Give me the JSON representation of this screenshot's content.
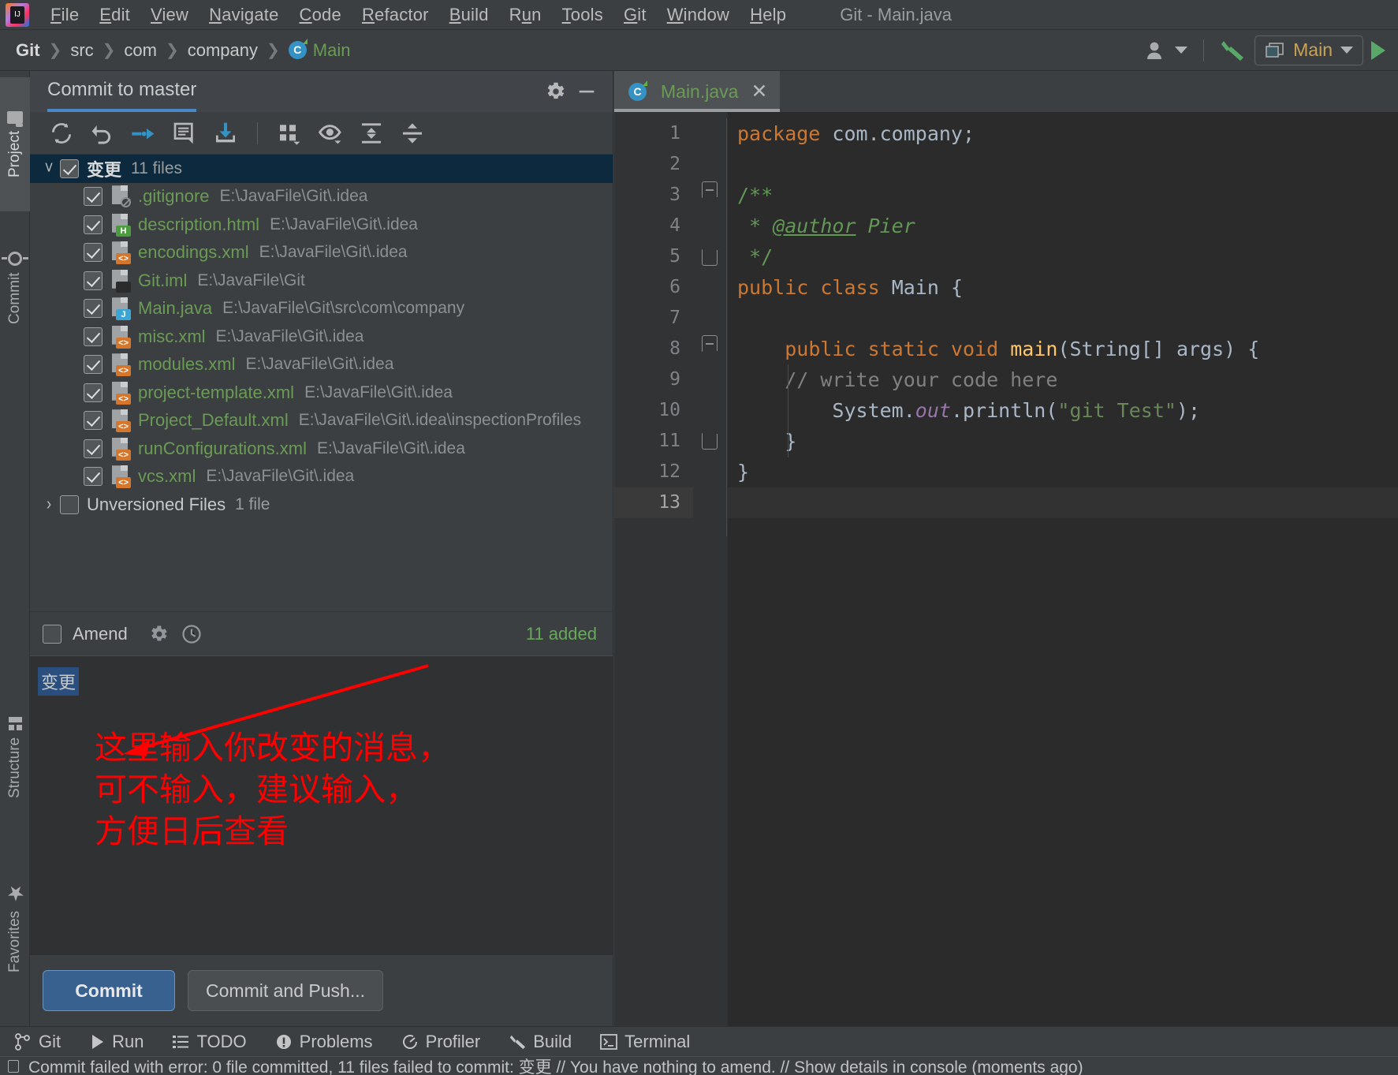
{
  "window": {
    "title": "Git - Main.java"
  },
  "menu": [
    {
      "label": "File",
      "mnemonic": "F"
    },
    {
      "label": "Edit",
      "mnemonic": "E"
    },
    {
      "label": "View",
      "mnemonic": "V"
    },
    {
      "label": "Navigate",
      "mnemonic": "N"
    },
    {
      "label": "Code",
      "mnemonic": "C"
    },
    {
      "label": "Refactor",
      "mnemonic": "R"
    },
    {
      "label": "Build",
      "mnemonic": "B"
    },
    {
      "label": "Run",
      "mnemonic": "u"
    },
    {
      "label": "Tools",
      "mnemonic": "T"
    },
    {
      "label": "Git",
      "mnemonic": "G"
    },
    {
      "label": "Window",
      "mnemonic": "W"
    },
    {
      "label": "Help",
      "mnemonic": "H"
    }
  ],
  "navbar": {
    "crumbs": [
      "Git",
      "src",
      "com",
      "company",
      "Main"
    ],
    "run_config": "Main"
  },
  "toolstrip": {
    "top": [
      {
        "label": "Project",
        "icon": "folder-icon",
        "selected": true
      },
      {
        "label": "Commit",
        "icon": "commit-icon",
        "selected": false
      }
    ],
    "bottom": [
      {
        "label": "Structure",
        "icon": "structure-icon"
      },
      {
        "label": "Favorites",
        "icon": "star-icon"
      }
    ]
  },
  "commit_panel": {
    "tab_title": "Commit to master",
    "root": {
      "label": "变更",
      "count": "11 files",
      "checked": true,
      "expanded": true
    },
    "files": [
      {
        "name": ".gitignore",
        "path": "E:\\JavaFile\\Git\\.idea",
        "type": "ign",
        "checked": true
      },
      {
        "name": "description.html",
        "path": "E:\\JavaFile\\Git\\.idea",
        "type": "html",
        "checked": true
      },
      {
        "name": "encodings.xml",
        "path": "E:\\JavaFile\\Git\\.idea",
        "type": "xml",
        "checked": true
      },
      {
        "name": "Git.iml",
        "path": "E:\\JavaFile\\Git",
        "type": "iml",
        "checked": true
      },
      {
        "name": "Main.java",
        "path": "E:\\JavaFile\\Git\\src\\com\\company",
        "type": "java",
        "checked": true
      },
      {
        "name": "misc.xml",
        "path": "E:\\JavaFile\\Git\\.idea",
        "type": "xml",
        "checked": true
      },
      {
        "name": "modules.xml",
        "path": "E:\\JavaFile\\Git\\.idea",
        "type": "xml",
        "checked": true
      },
      {
        "name": "project-template.xml",
        "path": "E:\\JavaFile\\Git\\.idea",
        "type": "xml",
        "checked": true
      },
      {
        "name": "Project_Default.xml",
        "path": "E:\\JavaFile\\Git\\.idea\\inspectionProfiles",
        "type": "xml",
        "checked": true
      },
      {
        "name": "runConfigurations.xml",
        "path": "E:\\JavaFile\\Git\\.idea",
        "type": "xml",
        "checked": true
      },
      {
        "name": "vcs.xml",
        "path": "E:\\JavaFile\\Git\\.idea",
        "type": "xml",
        "checked": true
      }
    ],
    "unversioned": {
      "label": "Unversioned Files",
      "count": "1 file",
      "checked": false,
      "expanded": false
    },
    "amend": {
      "label": "Amend",
      "checked": false
    },
    "added_count": "11 added",
    "message_value": "变更",
    "annotation": "这里输入你改变的消息，\n可不输入，建议输入，\n方便日后查看",
    "annotation_color": "#ff0000",
    "buttons": {
      "commit": "Commit",
      "commit_and_push": "Commit and Push..."
    }
  },
  "editor": {
    "tab_name": "Main.java",
    "lines": [
      {
        "n": "1",
        "runnable": false,
        "fold": "",
        "current": false
      },
      {
        "n": "2",
        "runnable": false,
        "fold": "",
        "current": false
      },
      {
        "n": "3",
        "runnable": false,
        "fold": "open",
        "current": false
      },
      {
        "n": "4",
        "runnable": false,
        "fold": "",
        "current": false
      },
      {
        "n": "5",
        "runnable": false,
        "fold": "close",
        "current": false
      },
      {
        "n": "6",
        "runnable": true,
        "fold": "",
        "current": false
      },
      {
        "n": "7",
        "runnable": false,
        "fold": "",
        "current": false
      },
      {
        "n": "8",
        "runnable": true,
        "fold": "open",
        "current": false
      },
      {
        "n": "9",
        "runnable": false,
        "fold": "",
        "current": false
      },
      {
        "n": "10",
        "runnable": false,
        "fold": "",
        "current": false
      },
      {
        "n": "11",
        "runnable": false,
        "fold": "close",
        "current": false
      },
      {
        "n": "12",
        "runnable": false,
        "fold": "",
        "current": false
      },
      {
        "n": "13",
        "runnable": false,
        "fold": "",
        "current": true
      }
    ],
    "code_text": [
      "package com.company;",
      "",
      "/**",
      " * @author Pier",
      " */",
      "public class Main {",
      "",
      "    public static void main(String[] args) {",
      "    // write your code here",
      "        System.out.println(\"git Test\");",
      "    }",
      "}",
      ""
    ]
  },
  "bottom_bar": [
    {
      "label": "Git",
      "icon": "git-branch-icon"
    },
    {
      "label": "Run",
      "icon": "play-icon"
    },
    {
      "label": "TODO",
      "icon": "list-icon"
    },
    {
      "label": "Problems",
      "icon": "error-icon"
    },
    {
      "label": "Profiler",
      "icon": "profiler-icon"
    },
    {
      "label": "Build",
      "icon": "hammer-icon"
    },
    {
      "label": "Terminal",
      "icon": "terminal-icon"
    }
  ],
  "status_bar": {
    "message": "Commit failed with error: 0 file committed, 11 files failed to commit: 变更 // You have nothing to amend. // Show details in console (moments ago)"
  },
  "colors": {
    "accent_blue": "#4a88c7",
    "file_green": "#6a9b55",
    "annotation_red": "#ff0000",
    "selection_blue": "#2a4f7f",
    "added_green": "#67a85b"
  }
}
